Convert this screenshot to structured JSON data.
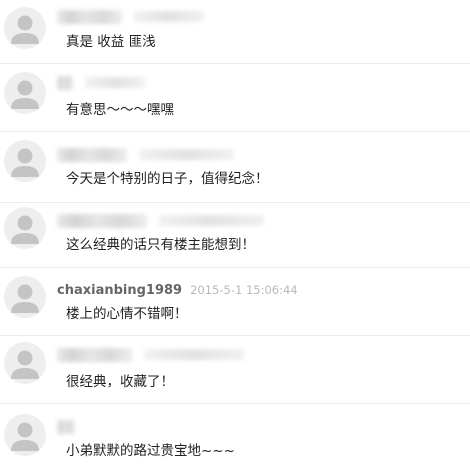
{
  "comments": [
    {
      "username": "",
      "time": "",
      "text": "真是 收益 匪浅"
    },
    {
      "username": "",
      "time": "",
      "text": "有意思～～～嘿嘿"
    },
    {
      "username": "",
      "time": "",
      "text": "今天是个特别的日子，值得纪念！"
    },
    {
      "username": "",
      "time": "",
      "text": "这么经典的话只有楼主能想到！"
    },
    {
      "username": "chaxianbing1989",
      "time": "2015-5-1 15:06:44",
      "text": "楼上的心情不错啊！"
    },
    {
      "username": "",
      "time": "",
      "text": "很经典，收藏了！"
    },
    {
      "username": "",
      "time": "",
      "text": "小弟默默的路过贵宝地~~~"
    }
  ],
  "icons": {
    "avatar": "default-user-avatar-icon"
  },
  "colors": {
    "username": "#666666",
    "timestamp": "#b9b9b9",
    "text": "#222222",
    "divider": "#ececec",
    "avatar_bg": "#eeeeee",
    "avatar_fg": "#c4c4c4"
  }
}
